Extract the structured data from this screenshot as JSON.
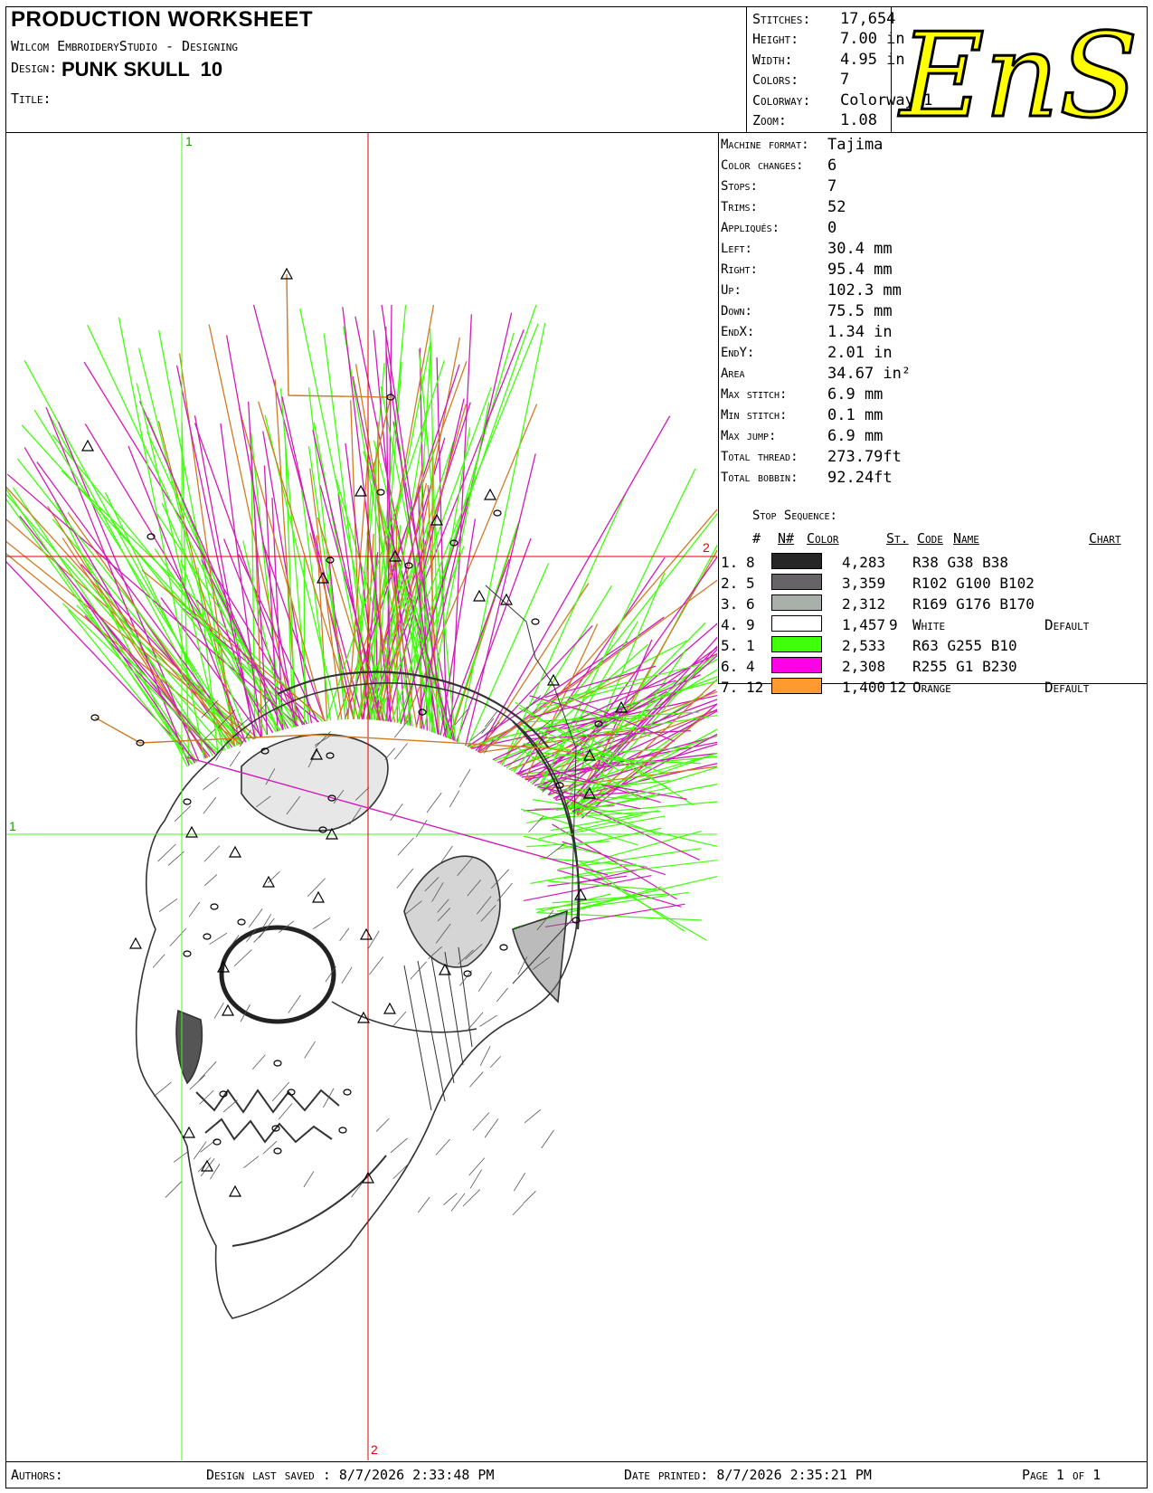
{
  "header": {
    "title": "PRODUCTION WORKSHEET",
    "software": "Wilcom EmbroideryStudio - Designing",
    "design_label": "Design:",
    "design_name": "PUNK SKULL  10",
    "title_label": "Title:"
  },
  "stats": [
    {
      "label": "Stitches:",
      "value": "17,654"
    },
    {
      "label": "Height:",
      "value": "7.00 in"
    },
    {
      "label": "Width:",
      "value": "4.95 in"
    },
    {
      "label": "Colors:",
      "value": "7"
    },
    {
      "label": "Colorway:",
      "value": "Colorway 1"
    },
    {
      "label": "Zoom:",
      "value": "1.08"
    }
  ],
  "logo": {
    "text": "EnS",
    "fill": "#ffff00",
    "stroke": "#000000"
  },
  "machine": [
    {
      "label": "Machine format:",
      "value": "Tajima"
    },
    {
      "label": "Color changes:",
      "value": "6"
    },
    {
      "label": "Stops:",
      "value": "7"
    },
    {
      "label": "Trims:",
      "value": "52"
    },
    {
      "label": "Appliqués:",
      "value": "0"
    },
    {
      "label": "Left:",
      "value": "30.4 mm"
    },
    {
      "label": "Right:",
      "value": "95.4 mm"
    },
    {
      "label": "Up:",
      "value": "102.3 mm"
    },
    {
      "label": "Down:",
      "value": "75.5 mm"
    },
    {
      "label": "EndX:",
      "value": "1.34 in"
    },
    {
      "label": "EndY:",
      "value": "2.01 in"
    },
    {
      "label": "Area",
      "value": " 34.67 in²"
    },
    {
      "label": "Max stitch:",
      "value": "6.9 mm"
    },
    {
      "label": "Min stitch:",
      "value": "0.1 mm"
    },
    {
      "label": "Max jump:",
      "value": "6.9 mm"
    },
    {
      "label": "Total thread:",
      "value": "273.79ft"
    },
    {
      "label": "Total bobbin:",
      "value": "92.24ft"
    }
  ],
  "stop_sequence": {
    "title": "Stop Sequence:",
    "headers": {
      "num": "#",
      "n": "N#",
      "color": "Color",
      "st": "St.",
      "code": "Code",
      "name": "Name",
      "chart": "Chart"
    },
    "rows": [
      {
        "num": "1.",
        "n": "8",
        "color": "#262626",
        "st": "4,283",
        "code": "",
        "name": "R38 G38 B38",
        "chart": ""
      },
      {
        "num": "2.",
        "n": "5",
        "color": "#666466",
        "st": "3,359",
        "code": "",
        "name": "R102 G100 B102",
        "chart": ""
      },
      {
        "num": "3.",
        "n": "6",
        "color": "#a9b0aa",
        "st": "2,312",
        "code": "",
        "name": "R169 G176 B170",
        "chart": ""
      },
      {
        "num": "4.",
        "n": "9",
        "color": "#ffffff",
        "st": "1,457",
        "code": "9",
        "name": "White",
        "chart": "Default"
      },
      {
        "num": "5.",
        "n": "1",
        "color": "#3fff0a",
        "st": "2,533",
        "code": "",
        "name": "R63 G255 B10",
        "chart": ""
      },
      {
        "num": "6.",
        "n": "4",
        "color": "#ff01e6",
        "st": "2,308",
        "code": "",
        "name": "R255 G1 B230",
        "chart": ""
      },
      {
        "num": "7.",
        "n": "12",
        "color": "#ff9a2e",
        "st": "1,400",
        "code": "12",
        "name": "Orange",
        "chart": "Default"
      }
    ]
  },
  "canvas": {
    "guide_labels": {
      "green_v": "1",
      "green_h": "1",
      "red_h": "2",
      "red_v": "2"
    },
    "colors": {
      "green": "#3fff0a",
      "red": "#e00000",
      "magenta": "#d21ab8",
      "orange": "#d07a24"
    }
  },
  "footer": {
    "authors": "Authors:",
    "saved": "Design last saved : 8/7/2026 2:33:48 PM",
    "printed": "Date printed: 8/7/2026 2:35:21 PM",
    "page": "Page 1 of 1"
  }
}
